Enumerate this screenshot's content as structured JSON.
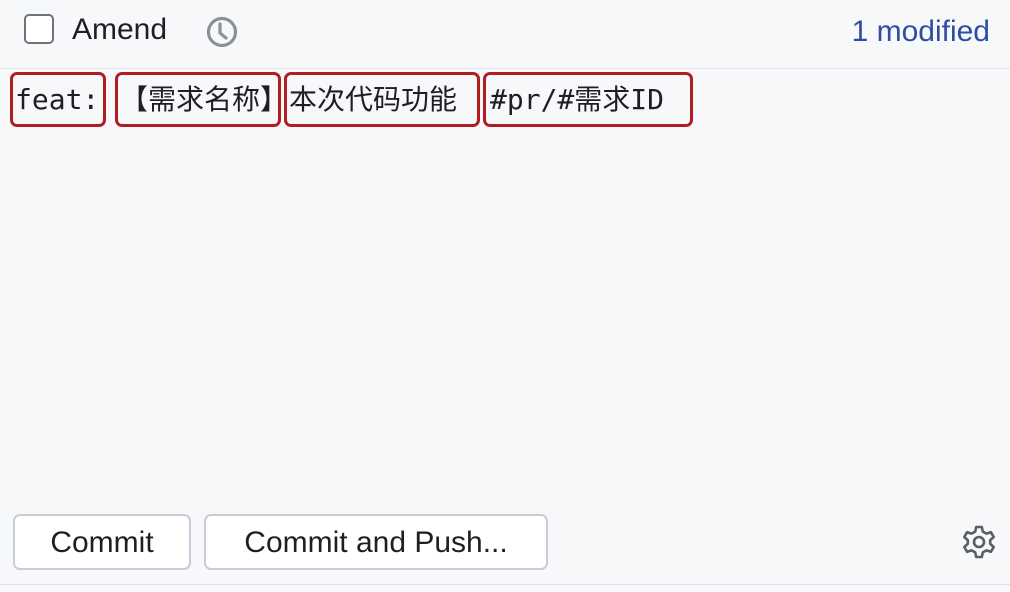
{
  "header": {
    "amend_checkbox_checked": false,
    "amend_label": "Amend",
    "history_icon": "clock-history-icon",
    "modified_link": "1 modified"
  },
  "commit_message": {
    "tokens": [
      "feat:",
      "【需求名称】",
      "本次代码功能",
      "#pr/#需求ID"
    ],
    "highlight_color": "#b01e23"
  },
  "actions": {
    "commit_label": "Commit",
    "commit_and_push_label": "Commit and Push...",
    "settings_icon": "gear-icon"
  },
  "colors": {
    "background": "#f7f8fa",
    "link": "#2f4da3",
    "button_border": "#c9ccd6"
  }
}
